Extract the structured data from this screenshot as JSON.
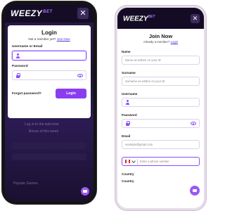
{
  "brand": {
    "logo_text": "WEEZY",
    "logo_suffix": "BET",
    "accent": "#8a3df0",
    "header_bg": "#150d26"
  },
  "left_phone": {
    "close_label": "✕",
    "background_lines": [
      "Log in to the welcome",
      "Bonus of this week",
      "Popular Games"
    ],
    "login": {
      "title": "Login",
      "subtitle_prefix": "Not a member yet?",
      "subtitle_link": "Join Now",
      "username_label": "Username or Email",
      "username_placeholder": "",
      "password_label": "Password",
      "password_placeholder": "",
      "forgot_label": "Forgot password?",
      "submit_label": "Login"
    }
  },
  "right_phone": {
    "close_label": "✕",
    "join": {
      "title": "Join Now",
      "subtitle_prefix": "Already a member?",
      "subtitle_link": "Login",
      "fields": {
        "name_label": "Name",
        "name_placeholder": "Name as written on your ID",
        "surname_label": "Surname",
        "surname_placeholder": "Surname as written on your ID",
        "username_label": "Username",
        "username_placeholder": "",
        "password_label": "Password",
        "password_placeholder": "",
        "email_label": "Email",
        "email_placeholder": "example@gmail.com",
        "phone_placeholder": "Enter a phone number",
        "country_label": "Country",
        "country2_label": "Country"
      }
    }
  }
}
